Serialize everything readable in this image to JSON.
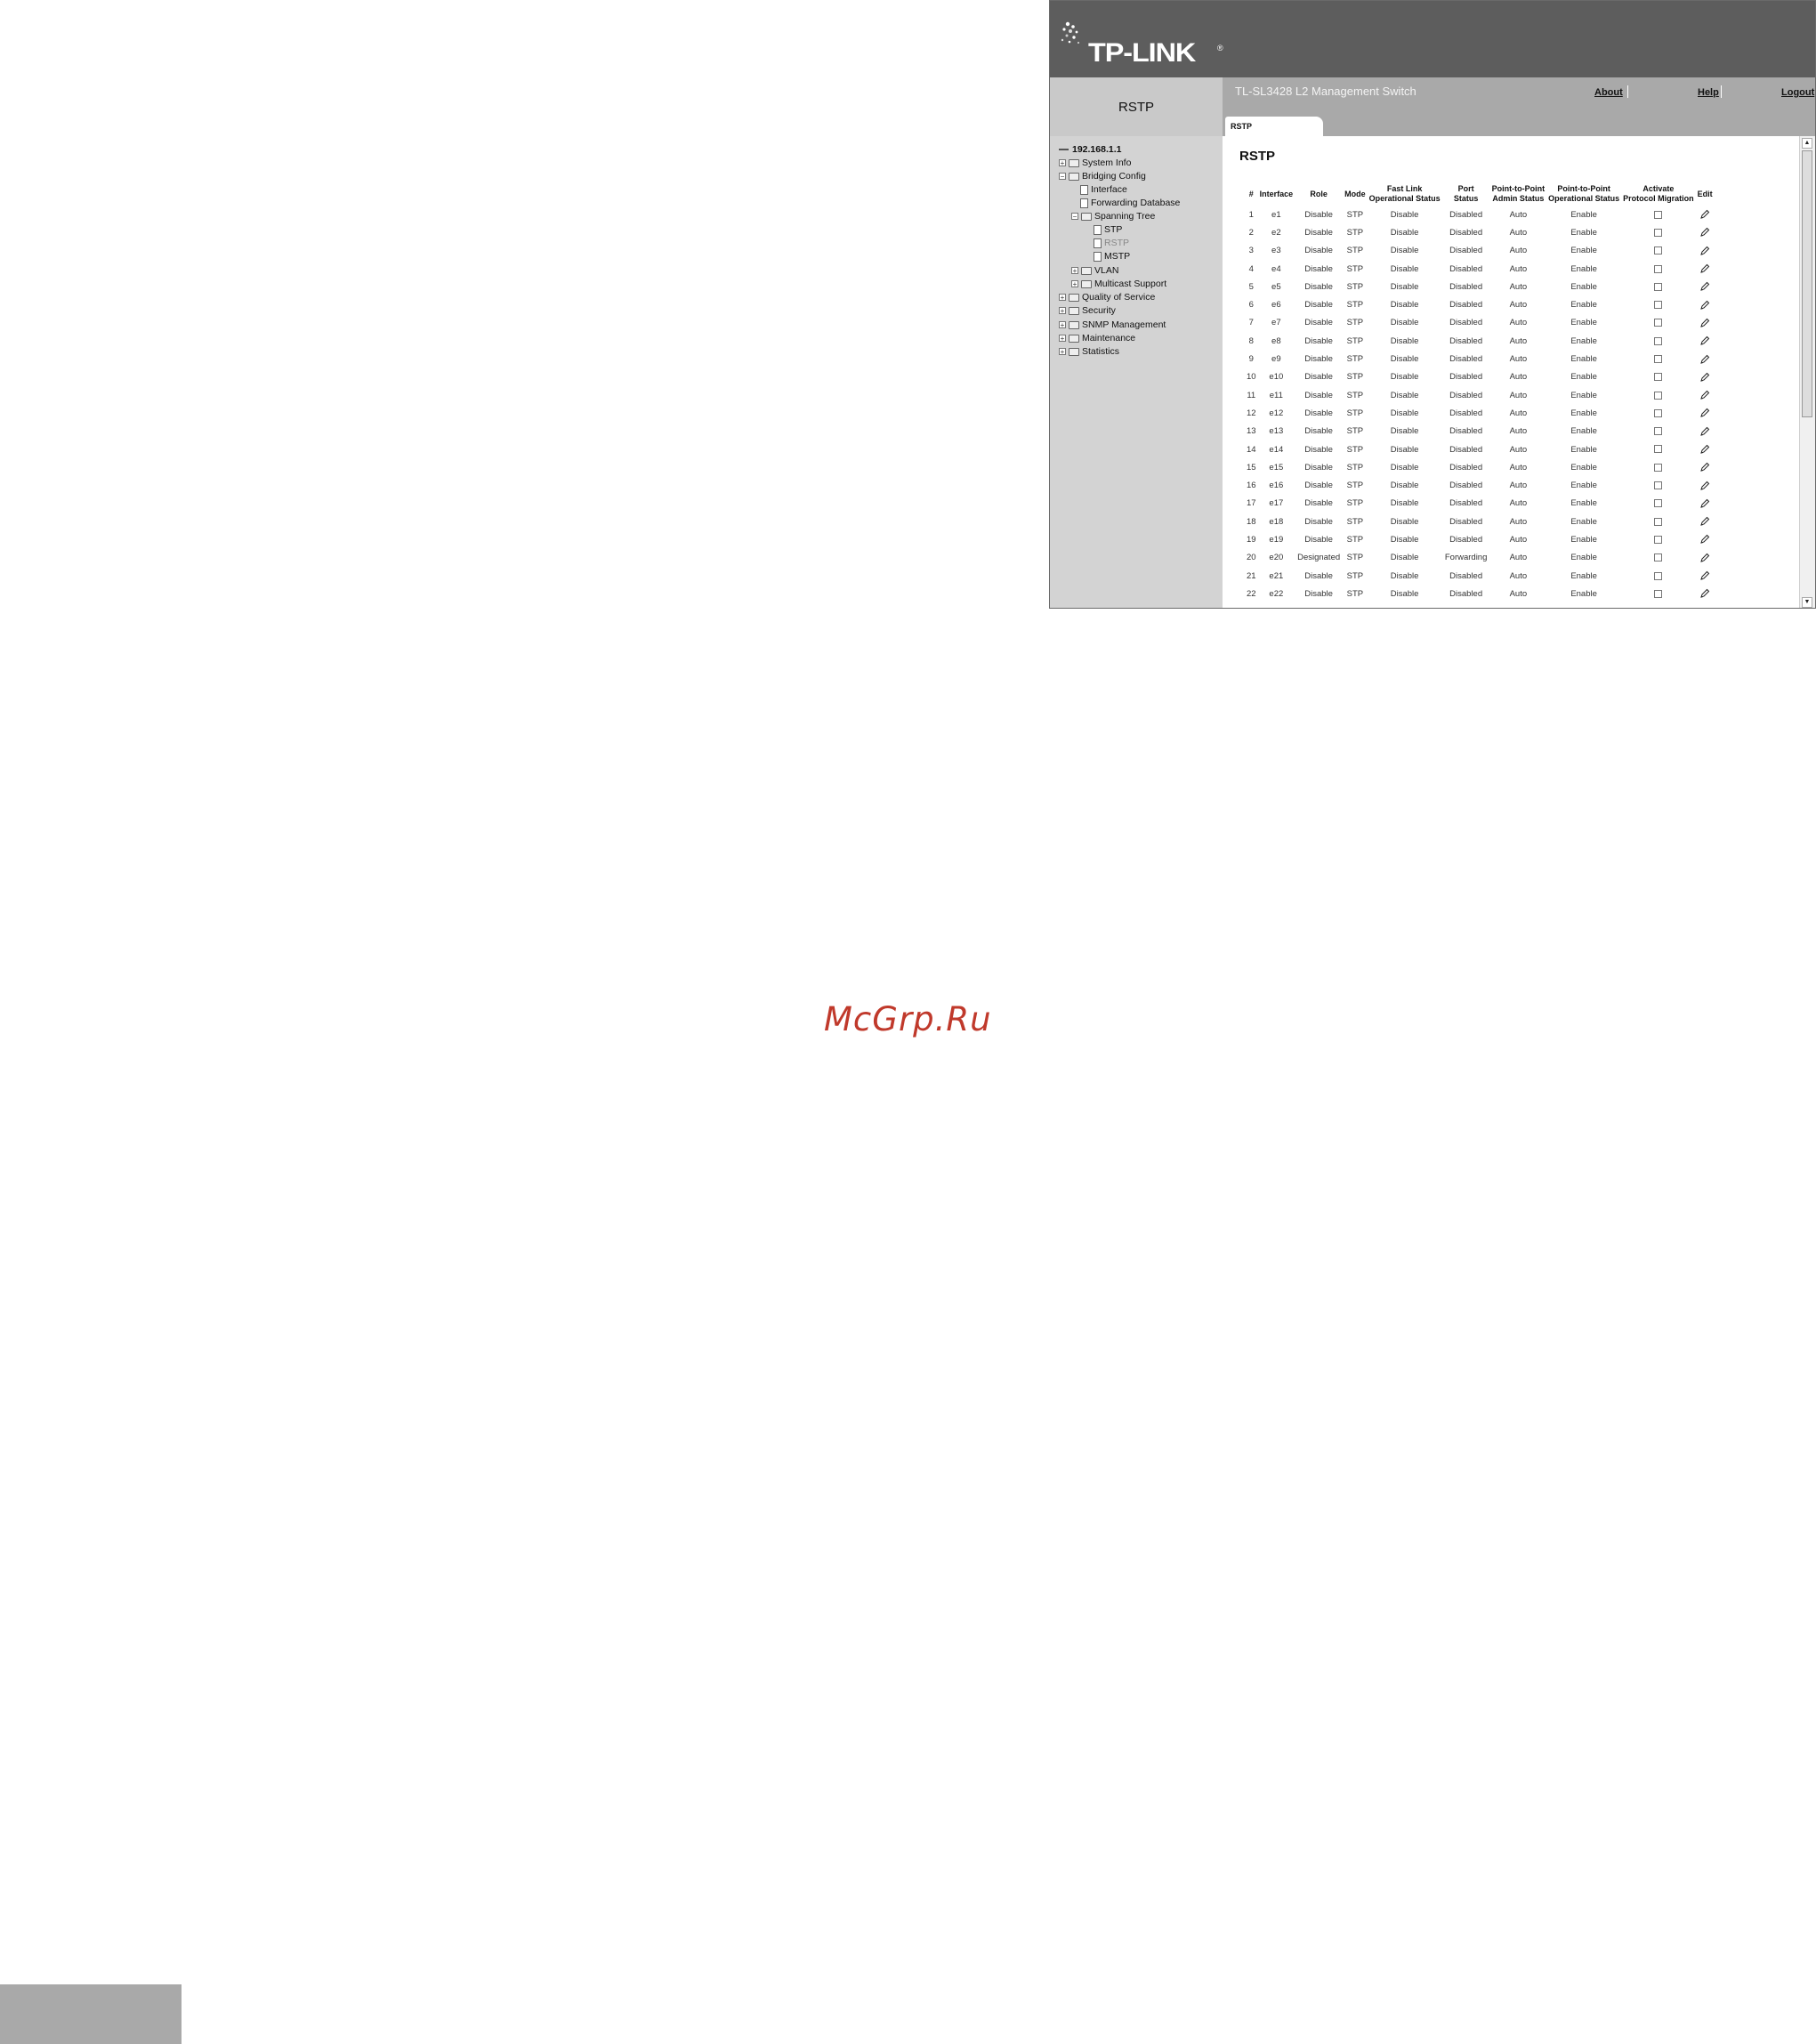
{
  "brand": {
    "logo_text": "TP-LINK",
    "registered": "®"
  },
  "header": {
    "page_label": "RSTP",
    "product": "TL-SL3428 L2 Management Switch",
    "links": {
      "about": "About",
      "help": "Help",
      "logout": "Logout"
    },
    "tab": "RSTP"
  },
  "sidebar": {
    "root": "192.168.1.1",
    "system_info": "System Info",
    "bridging_config": "Bridging Config",
    "interface": "Interface",
    "forwarding_database": "Forwarding Database",
    "spanning_tree": "Spanning Tree",
    "stp": "STP",
    "rstp": "RSTP",
    "mstp": "MSTP",
    "vlan": "VLAN",
    "multicast_support": "Multicast Support",
    "quality_of_service": "Quality of Service",
    "security": "Security",
    "snmp_management": "SNMP Management",
    "maintenance": "Maintenance",
    "statistics": "Statistics"
  },
  "main": {
    "title": "RSTP",
    "columns": {
      "num": "#",
      "interface": "Interface",
      "role": "Role",
      "mode": "Mode",
      "fast_link_1": "Fast Link",
      "fast_link_2": "Operational Status",
      "port_status_1": "Port",
      "port_status_2": "Status",
      "p2p_admin_1": "Point-to-Point",
      "p2p_admin_2": "Admin Status",
      "p2p_oper_1": "Point-to-Point",
      "p2p_oper_2": "Operational Status",
      "activate_1": "Activate",
      "activate_2": "Protocol Migration",
      "edit": "Edit"
    },
    "rows": [
      [
        "1",
        "e1",
        "Disable",
        "STP",
        "Disable",
        "Disabled",
        "Auto",
        "Enable"
      ],
      [
        "2",
        "e2",
        "Disable",
        "STP",
        "Disable",
        "Disabled",
        "Auto",
        "Enable"
      ],
      [
        "3",
        "e3",
        "Disable",
        "STP",
        "Disable",
        "Disabled",
        "Auto",
        "Enable"
      ],
      [
        "4",
        "e4",
        "Disable",
        "STP",
        "Disable",
        "Disabled",
        "Auto",
        "Enable"
      ],
      [
        "5",
        "e5",
        "Disable",
        "STP",
        "Disable",
        "Disabled",
        "Auto",
        "Enable"
      ],
      [
        "6",
        "e6",
        "Disable",
        "STP",
        "Disable",
        "Disabled",
        "Auto",
        "Enable"
      ],
      [
        "7",
        "e7",
        "Disable",
        "STP",
        "Disable",
        "Disabled",
        "Auto",
        "Enable"
      ],
      [
        "8",
        "e8",
        "Disable",
        "STP",
        "Disable",
        "Disabled",
        "Auto",
        "Enable"
      ],
      [
        "9",
        "e9",
        "Disable",
        "STP",
        "Disable",
        "Disabled",
        "Auto",
        "Enable"
      ],
      [
        "10",
        "e10",
        "Disable",
        "STP",
        "Disable",
        "Disabled",
        "Auto",
        "Enable"
      ],
      [
        "11",
        "e11",
        "Disable",
        "STP",
        "Disable",
        "Disabled",
        "Auto",
        "Enable"
      ],
      [
        "12",
        "e12",
        "Disable",
        "STP",
        "Disable",
        "Disabled",
        "Auto",
        "Enable"
      ],
      [
        "13",
        "e13",
        "Disable",
        "STP",
        "Disable",
        "Disabled",
        "Auto",
        "Enable"
      ],
      [
        "14",
        "e14",
        "Disable",
        "STP",
        "Disable",
        "Disabled",
        "Auto",
        "Enable"
      ],
      [
        "15",
        "e15",
        "Disable",
        "STP",
        "Disable",
        "Disabled",
        "Auto",
        "Enable"
      ],
      [
        "16",
        "e16",
        "Disable",
        "STP",
        "Disable",
        "Disabled",
        "Auto",
        "Enable"
      ],
      [
        "17",
        "e17",
        "Disable",
        "STP",
        "Disable",
        "Disabled",
        "Auto",
        "Enable"
      ],
      [
        "18",
        "e18",
        "Disable",
        "STP",
        "Disable",
        "Disabled",
        "Auto",
        "Enable"
      ],
      [
        "19",
        "e19",
        "Disable",
        "STP",
        "Disable",
        "Disabled",
        "Auto",
        "Enable"
      ],
      [
        "20",
        "e20",
        "Designated",
        "STP",
        "Disable",
        "Forwarding",
        "Auto",
        "Enable"
      ],
      [
        "21",
        "e21",
        "Disable",
        "STP",
        "Disable",
        "Disabled",
        "Auto",
        "Enable"
      ],
      [
        "22",
        "e22",
        "Disable",
        "STP",
        "Disable",
        "Disabled",
        "Auto",
        "Enable"
      ]
    ]
  },
  "watermark": "McGrp.Ru",
  "colors": {
    "banner": "#5d5d5d",
    "headbar": "#a9a9a9",
    "sidebar": "#d3d3d3",
    "watermark": "#c0392b"
  }
}
